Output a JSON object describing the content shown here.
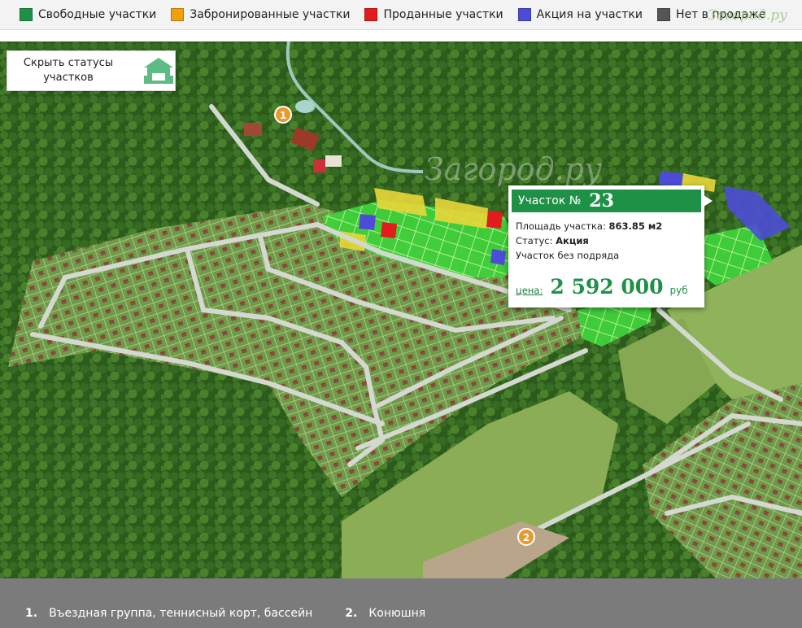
{
  "legend": {
    "items": [
      {
        "label": "Свободные участки",
        "color": "#1f9146"
      },
      {
        "label": "Забронированные участки",
        "color": "#f0a00a"
      },
      {
        "label": "Проданные участки",
        "color": "#e31b1b"
      },
      {
        "label": "Акция на участки",
        "color": "#4c4cd6"
      },
      {
        "label": "Нет в продаже",
        "color": "#555555"
      }
    ],
    "watermark": "Загород.ру"
  },
  "controls": {
    "hide_statuses_label": "Скрыть статусы участков",
    "hide_statuses_icon": "house-icon"
  },
  "map": {
    "watermark": "Загород.ру",
    "markers": [
      {
        "number": "1",
        "icon": "marker-icon"
      },
      {
        "number": "2",
        "icon": "marker-icon"
      }
    ]
  },
  "popup": {
    "header_label": "Участок №",
    "plot_number": "23",
    "area_label": "Площадь участка:",
    "area_value": "863.85 м2",
    "status_label": "Статус:",
    "status_value": "Акция",
    "note": "Участок без подряда",
    "price_label": "цена:",
    "price_value": "2 592 000",
    "price_currency": "руб"
  },
  "footer": {
    "items": [
      {
        "number": "1.",
        "label": "Въездная группа, теннисный корт, бассейн"
      },
      {
        "number": "2.",
        "label": "Конюшня"
      }
    ]
  },
  "colors": {
    "free": "#3fd13a",
    "booked": "#e9d63a",
    "sold": "#e31b1b",
    "promo": "#4c4cd6",
    "forest": "#2f5a1e",
    "meadow": "#8aab55",
    "road": "#cfd4cf"
  }
}
